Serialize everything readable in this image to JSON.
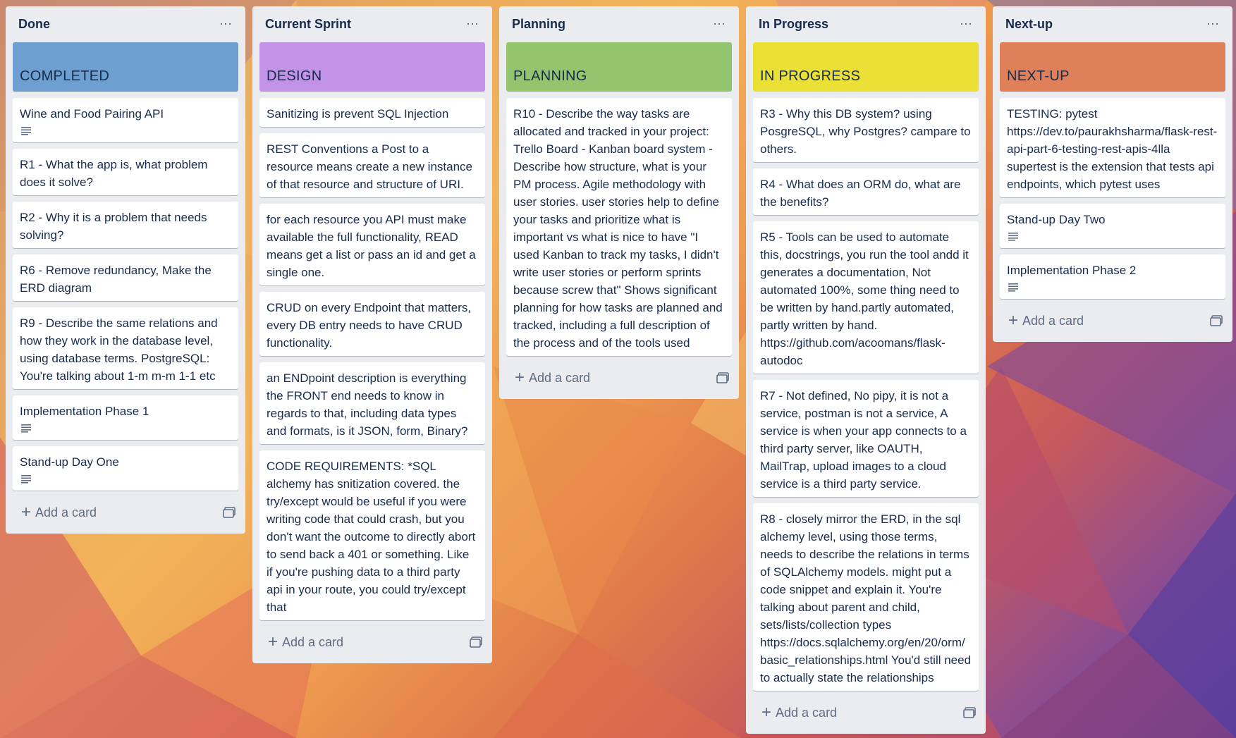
{
  "add_card_label": "Add a card",
  "lists": [
    {
      "title": "Done",
      "label": {
        "text": "COMPLETED",
        "color": "#6d9fd1"
      },
      "cards": [
        {
          "text": "Wine and Food Pairing API",
          "has_description": true
        },
        {
          "text": "R1 - What the app is, what problem does it solve?",
          "has_description": false
        },
        {
          "text": "R2 - Why it is a problem that needs solving?",
          "has_description": false
        },
        {
          "text": "R6 - Remove redundancy, Make the ERD diagram",
          "has_description": false
        },
        {
          "text": "R9 - Describe the same relations and how they work in the database level, using database terms. PostgreSQL: You're talking about 1-m m-m 1-1 etc",
          "has_description": false
        },
        {
          "text": "Implementation Phase 1",
          "has_description": true
        },
        {
          "text": "Stand-up Day One",
          "has_description": true
        }
      ]
    },
    {
      "title": "Current Sprint",
      "label": {
        "text": "DESIGN",
        "color": "#c192e5"
      },
      "cards": [
        {
          "text": "Sanitizing is prevent SQL Injection",
          "has_description": false
        },
        {
          "text": "REST Conventions a Post to a resource means create a new instance of that resource and structure of URI.",
          "has_description": false
        },
        {
          "text": "for each resource you API must make available the full functionality, READ means get a list or pass an id and get a single one.",
          "has_description": false
        },
        {
          "text": "CRUD on every Endpoint that matters, every DB entry needs to have CRUD functionality.",
          "has_description": false
        },
        {
          "text": "an ENDpoint description is everything the FRONT end needs to know in regards to that, including data types and formats, is it JSON, form, Binary?",
          "has_description": false
        },
        {
          "text": "CODE REQUIREMENTS: *SQL alchemy has snitization covered. the try/except would be useful if you were writing code that could crash, but you don't want the outcome to directly abort to send back a 401 or something. Like if you're pushing data to a third party api in your route, you could try/except that",
          "has_description": false
        }
      ]
    },
    {
      "title": "Planning",
      "label": {
        "text": "PLANNING",
        "color": "#93c56e"
      },
      "cards": [
        {
          "text": "R10 - Describe the way tasks are allocated and tracked in your project: Trello Board - Kanban board system - Describe how structure, what is your PM process. Agile methodology with user stories. user stories help to define your tasks and prioritize what is important vs what is nice to have \"I used Kanban to track my tasks, I didn't write user stories or perform sprints because screw that\" Shows significant planning for how tasks are planned and tracked, including a full description of the process and of the tools used",
          "has_description": false
        }
      ]
    },
    {
      "title": "In Progress",
      "label": {
        "text": "IN PROGRESS",
        "color": "#ebe035"
      },
      "cards": [
        {
          "text": "R3 - Why this DB system? using PosgreSQL, why Postgres? campare to others.",
          "has_description": false
        },
        {
          "text": "R4 - What does an ORM do, what are the benefits?",
          "has_description": false
        },
        {
          "text": "R5 - Tools can be used to automate this, docstrings, you run the tool andd it generates a documentation, Not automated 100%, some thing need to be written by hand.partly automated, partly written by hand. https://github.com/acoomans/flask-autodoc",
          "has_description": false
        },
        {
          "text": "R7 - Not defined, No pipy, it is not a service, postman is not a service, A service is when your app connects to a third party server, like OAUTH, MailTrap, upload images to a cloud service is a third party service.",
          "has_description": false
        },
        {
          "text": "R8 - closely mirror the ERD, in the sql alchemy level, using those terms, needs to describe the relations in terms of SQLAlchemy models. might put a code snippet and explain it. You're talking about parent and child, sets/lists/collection types https://docs.sqlalchemy.org/en/20/orm/basic_relationships.html You'd still need to actually state the relationships",
          "has_description": false
        }
      ]
    },
    {
      "title": "Next-up",
      "label": {
        "text": "NEXT-UP",
        "color": "#e0805a"
      },
      "cards": [
        {
          "text": "TESTING: pytest https://dev.to/paurakhsharma/flask-rest-api-part-6-testing-rest-apis-4lla supertest is the extension that tests api endpoints, which pytest uses",
          "has_description": false
        },
        {
          "text": "Stand-up Day Two",
          "has_description": true
        },
        {
          "text": "Implementation Phase 2",
          "has_description": true
        }
      ]
    }
  ]
}
